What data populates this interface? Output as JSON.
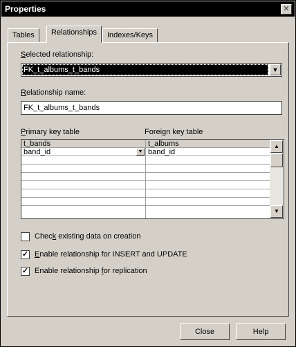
{
  "window": {
    "title": "Properties",
    "close_glyph": "✕"
  },
  "tabs": [
    {
      "label": "Tables"
    },
    {
      "label": "Relationships"
    },
    {
      "label": "Indexes/Keys"
    }
  ],
  "selected_relationship": {
    "label_pre": "",
    "label_key": "S",
    "label_post": "elected relationship:",
    "value": "FK_t_albums_t_bands"
  },
  "relationship_name": {
    "label_key": "R",
    "label_post": "elationship name:",
    "value": "FK_t_albums_t_bands"
  },
  "primary_key_table": {
    "label_key": "P",
    "label_post": "rimary key table"
  },
  "foreign_key_table": {
    "label": "Foreign key table"
  },
  "grid": {
    "header": [
      "t_bands",
      "t_albums"
    ],
    "rows": [
      [
        "band_id",
        "band_id"
      ],
      [
        "",
        ""
      ],
      [
        "",
        ""
      ],
      [
        "",
        ""
      ],
      [
        "",
        ""
      ],
      [
        "",
        ""
      ],
      [
        "",
        ""
      ]
    ]
  },
  "checkboxes": [
    {
      "pre": "Chec",
      "key": "k",
      "post": " existing data on creation",
      "checked": false
    },
    {
      "pre": "",
      "key": "E",
      "post": "nable relationship for INSERT and UPDATE",
      "checked": true
    },
    {
      "pre": "Enable relationship ",
      "key": "f",
      "post": "or replication",
      "checked": true
    }
  ],
  "buttons": {
    "close": "Close",
    "help": "Help"
  }
}
